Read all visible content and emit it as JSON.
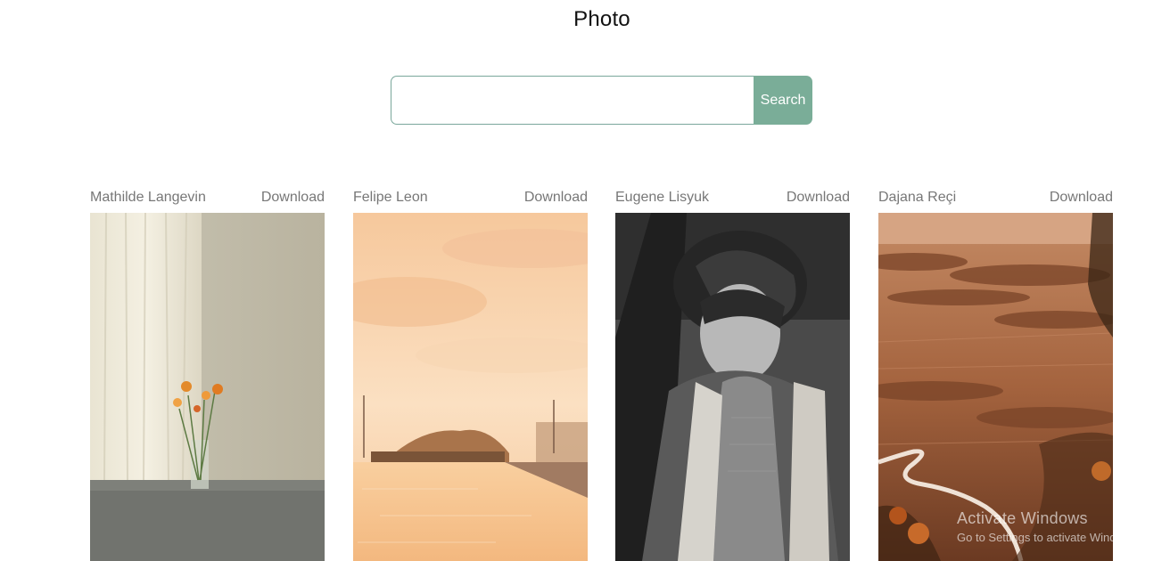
{
  "header": {
    "title": "Photo"
  },
  "search": {
    "placeholder": "",
    "value": "",
    "button_label": "Search"
  },
  "photos": [
    {
      "author": "Mathilde Langevin",
      "download_label": "Download"
    },
    {
      "author": "Felipe Leon",
      "download_label": "Download"
    },
    {
      "author": "Eugene Lisyuk",
      "download_label": "Download"
    },
    {
      "author": "Dajana Reçi",
      "download_label": "Download"
    }
  ],
  "os_watermark": {
    "title": "Activate Windows",
    "subtitle": "Go to Settings to activate Windows."
  },
  "colors": {
    "accent": "#7aad98",
    "input_border": "#7aa79b",
    "meta_text": "#777777"
  }
}
